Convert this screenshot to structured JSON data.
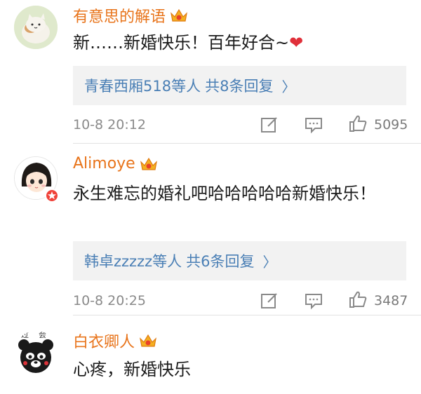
{
  "comments": [
    {
      "username": "有意思的解语",
      "text": "新……新婚快乐！百年好合~",
      "heart": "❤",
      "replies_users": "青春西厢518等人",
      "replies_count": "共8条回复",
      "time": "10-8 20:12",
      "likes": "5095"
    },
    {
      "username": "Alimoye",
      "text": "永生难忘的婚礼吧哈哈哈哈哈新婚快乐！",
      "replies_users": "韩卓zzzzz等人",
      "replies_count": "共6条回复",
      "time": "10-8 20:25",
      "likes": "3487"
    },
    {
      "username": "白衣卿人",
      "text": "心疼，新婚快乐",
      "avatar_caption": "过会"
    }
  ],
  "colors": {
    "username": "#e8741b",
    "link": "#4a7fb5",
    "meta": "#8a8a8a",
    "reply_bg": "#f2f2f2",
    "heart": "#e0303a"
  },
  "icons": [
    "vip-crown-icon",
    "edit-icon",
    "comment-icon",
    "thumbs-up-icon",
    "chevron-right-icon"
  ]
}
